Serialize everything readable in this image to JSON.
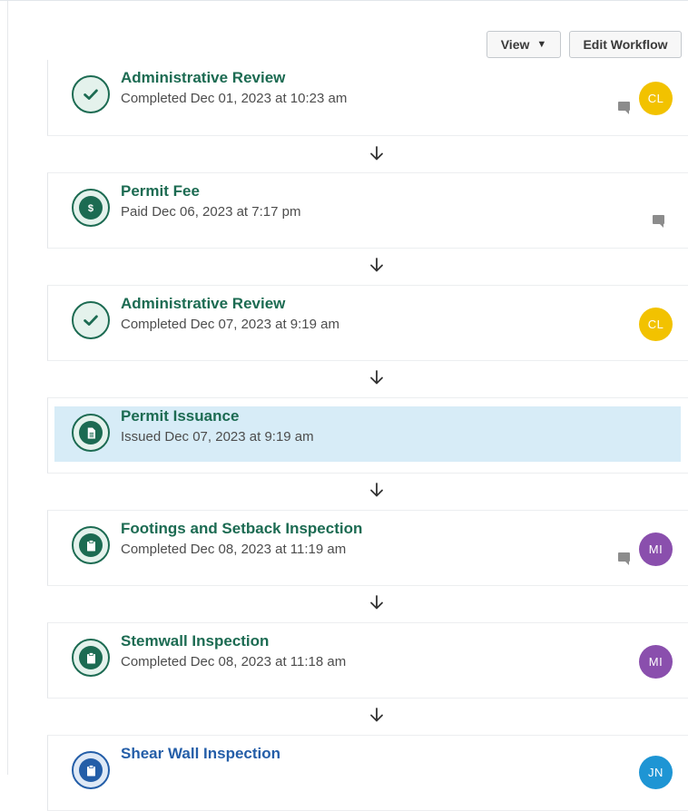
{
  "toolbar": {
    "view_label": "View",
    "edit_label": "Edit Workflow"
  },
  "colors": {
    "step_green": "#1c6b52",
    "step_blue": "#245ea8",
    "highlight_bg": "#d7ecf7",
    "avatar_yellow": "#f2c200",
    "avatar_purple": "#8a4fad",
    "avatar_blue": "#1e95d4"
  },
  "steps": [
    {
      "title": "Administrative Review",
      "status": "Completed Dec 01, 2023 at 10:23 am",
      "icon": "check-icon",
      "has_comment": true,
      "avatar": "CL",
      "avatar_color": "#f2c200"
    },
    {
      "title": "Permit Fee",
      "status": "Paid Dec 06, 2023 at 7:17 pm",
      "icon": "dollar-icon",
      "has_comment": true,
      "avatar": null
    },
    {
      "title": "Administrative Review",
      "status": "Completed Dec 07, 2023 at 9:19 am",
      "icon": "check-icon",
      "has_comment": false,
      "avatar": "CL",
      "avatar_color": "#f2c200"
    },
    {
      "title": "Permit Issuance",
      "status": "Issued Dec 07, 2023 at 9:19 am",
      "icon": "document-icon",
      "has_comment": false,
      "avatar": null,
      "highlighted": true
    },
    {
      "title": "Footings and Setback Inspection",
      "status": "Completed Dec 08, 2023 at 11:19 am",
      "icon": "clipboard-icon",
      "has_comment": true,
      "avatar": "MI",
      "avatar_color": "#8a4fad"
    },
    {
      "title": "Stemwall Inspection",
      "status": "Completed Dec 08, 2023 at 11:18 am",
      "icon": "clipboard-icon",
      "has_comment": false,
      "avatar": "MI",
      "avatar_color": "#8a4fad"
    },
    {
      "title": "Shear Wall Inspection",
      "status": "",
      "icon": "clipboard-icon",
      "has_comment": false,
      "avatar": "JN",
      "avatar_color": "#1e95d4",
      "pending": true
    }
  ]
}
